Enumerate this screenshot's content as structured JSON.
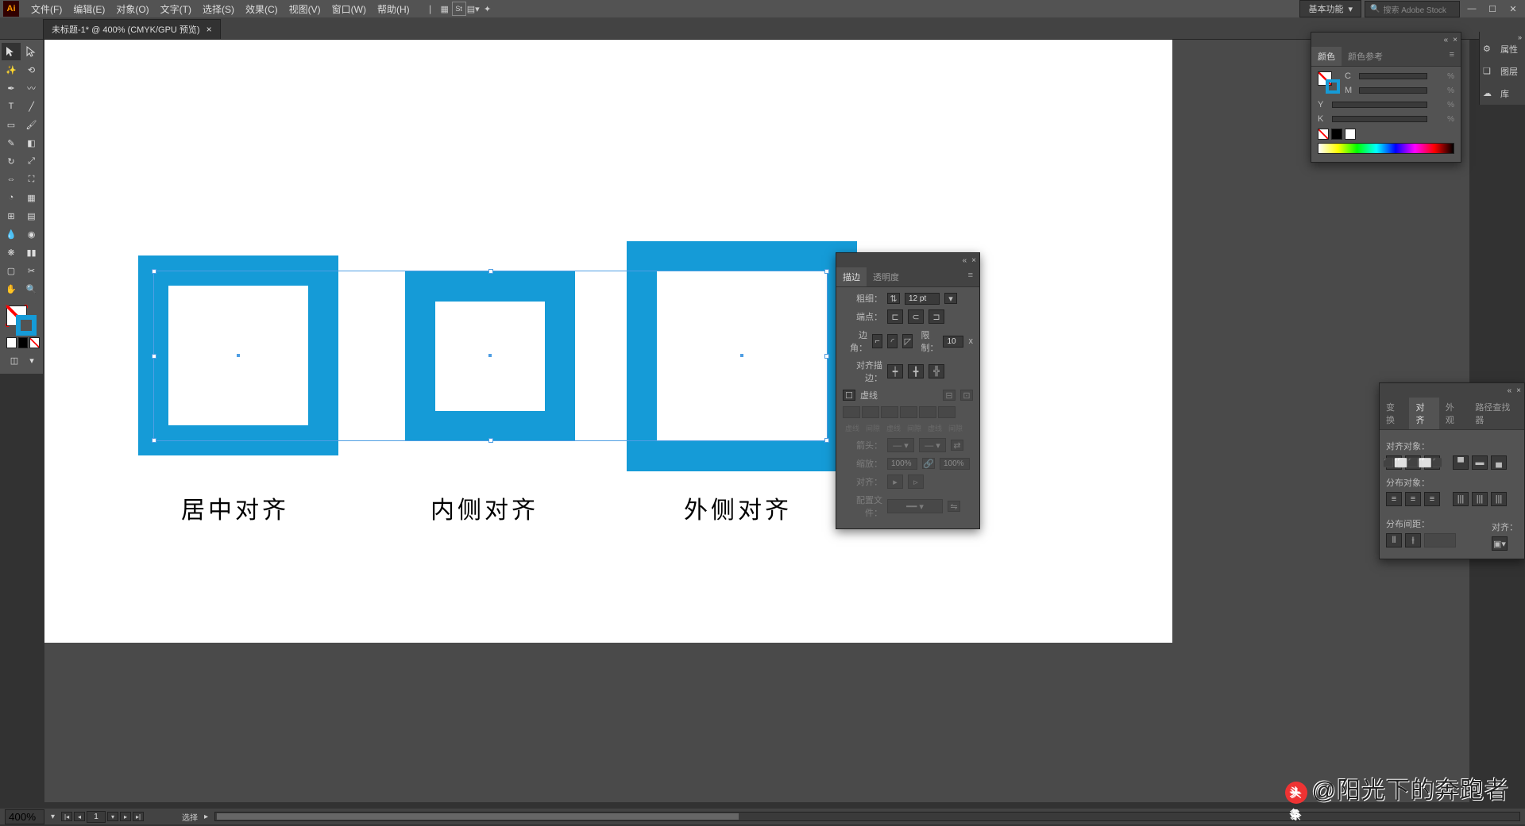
{
  "menubar": {
    "items": [
      "文件(F)",
      "编辑(E)",
      "对象(O)",
      "文字(T)",
      "选择(S)",
      "效果(C)",
      "视图(V)",
      "窗口(W)",
      "帮助(H)"
    ],
    "workspace": "基本功能",
    "search_placeholder": "搜索 Adobe Stock"
  },
  "tab": {
    "title": "未标题-1* @ 400% (CMYK/GPU 预览)"
  },
  "canvas_labels": {
    "center": "居中对齐",
    "inside": "内侧对齐",
    "outside": "外侧对齐"
  },
  "color_panel": {
    "tabs": [
      "颜色",
      "颜色参考"
    ],
    "channels": [
      "C",
      "M",
      "Y",
      "K"
    ],
    "pct": "%"
  },
  "stroke_panel": {
    "tabs": [
      "描边",
      "透明度"
    ],
    "weight_label": "粗细：",
    "weight_value": "12 pt",
    "cap_label": "端点：",
    "corner_label": "边角：",
    "limit_label": "限制：",
    "limit_value": "10",
    "limit_unit": "x",
    "align_stroke_label": "对齐描边：",
    "dashed_label": "虚线",
    "dash_labels": [
      "虚线",
      "间隙",
      "虚线",
      "间隙",
      "虚线",
      "间隙"
    ],
    "arrow_label": "箭头：",
    "scale_label": "缩放：",
    "scale_val": "100%",
    "align2_label": "对齐：",
    "profile_label": "配置文件："
  },
  "align_panel": {
    "tabs": [
      "变换",
      "对齐",
      "外观",
      "路径查找器"
    ],
    "align_obj_label": "对齐对象：",
    "distribute_label": "分布对象：",
    "spacing_label": "分布间距：",
    "alignto_label": "对齐："
  },
  "right_dock": {
    "items": [
      "属性",
      "图层",
      "库"
    ]
  },
  "statusbar": {
    "zoom": "400%",
    "page": "1",
    "label": "选择"
  },
  "watermark": {
    "logo": "头条",
    "text": "@阳光下的奔跑者"
  }
}
